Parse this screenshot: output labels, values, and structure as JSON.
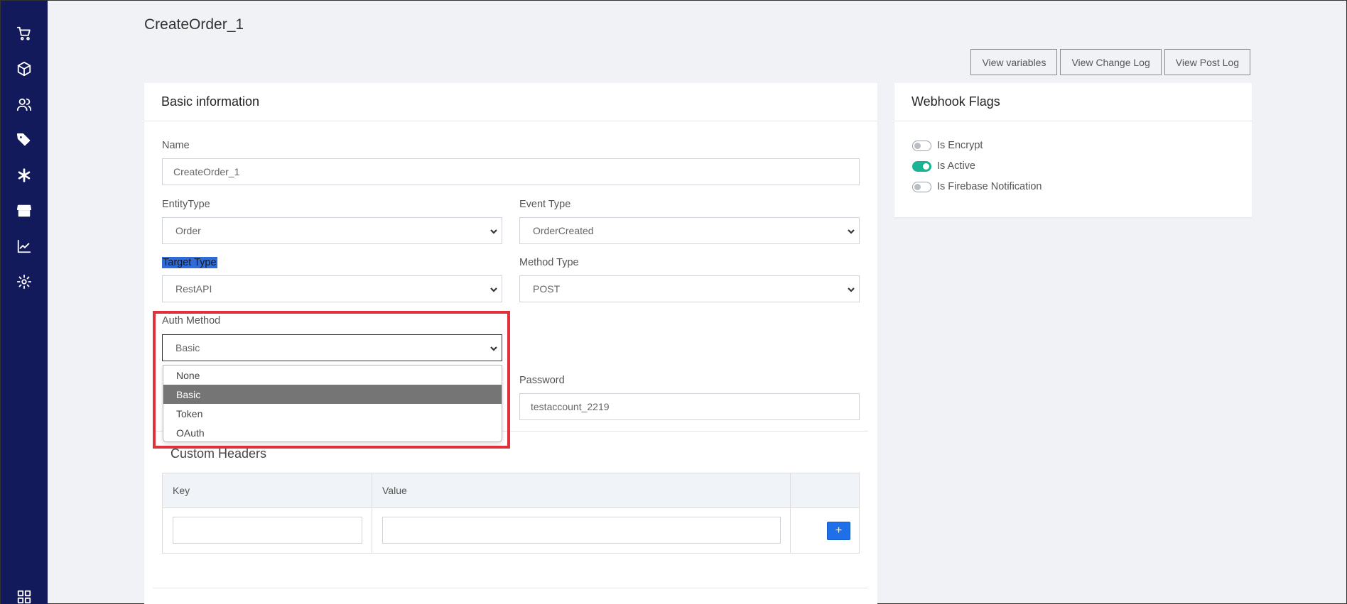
{
  "page": {
    "title": "CreateOrder_1"
  },
  "sidebar": {
    "items": [
      {
        "icon": "cart-icon"
      },
      {
        "icon": "box-icon"
      },
      {
        "icon": "users-icon"
      },
      {
        "icon": "tags-icon"
      },
      {
        "icon": "asterisk-icon"
      },
      {
        "icon": "store-icon"
      },
      {
        "icon": "chart-line-icon"
      },
      {
        "icon": "gear-icon"
      },
      {
        "icon": "grid-icon"
      }
    ]
  },
  "toolbar": {
    "view_variables": "View variables",
    "view_change_log": "View Change Log",
    "view_post_log": "View Post Log"
  },
  "basic": {
    "header": "Basic information",
    "name_label": "Name",
    "name_value": "CreateOrder_1",
    "entity_label": "EntityType",
    "entity_value": "Order",
    "event_label": "Event Type",
    "event_value": "OrderCreated",
    "target_label": "Target Type",
    "target_value": "RestAPI",
    "method_label": "Method Type",
    "method_value": "POST",
    "auth_label": "Auth Method",
    "auth_value": "Basic",
    "auth_options": [
      "None",
      "Basic",
      "Token",
      "OAuth"
    ],
    "password_label": "Password",
    "password_value": "testaccount_2219"
  },
  "headers": {
    "title": "Custom Headers",
    "col_key": "Key",
    "col_value": "Value",
    "add_label": "+"
  },
  "flags": {
    "header": "Webhook Flags",
    "items": [
      {
        "label": "Is Encrypt",
        "on": false
      },
      {
        "label": "Is Active",
        "on": true
      },
      {
        "label": "Is Firebase Notification",
        "on": false
      }
    ]
  },
  "colors": {
    "sidebar": "#121a5c",
    "accent": "#1ab394",
    "button": "#1e6fe8",
    "outline": "#e0303a"
  }
}
